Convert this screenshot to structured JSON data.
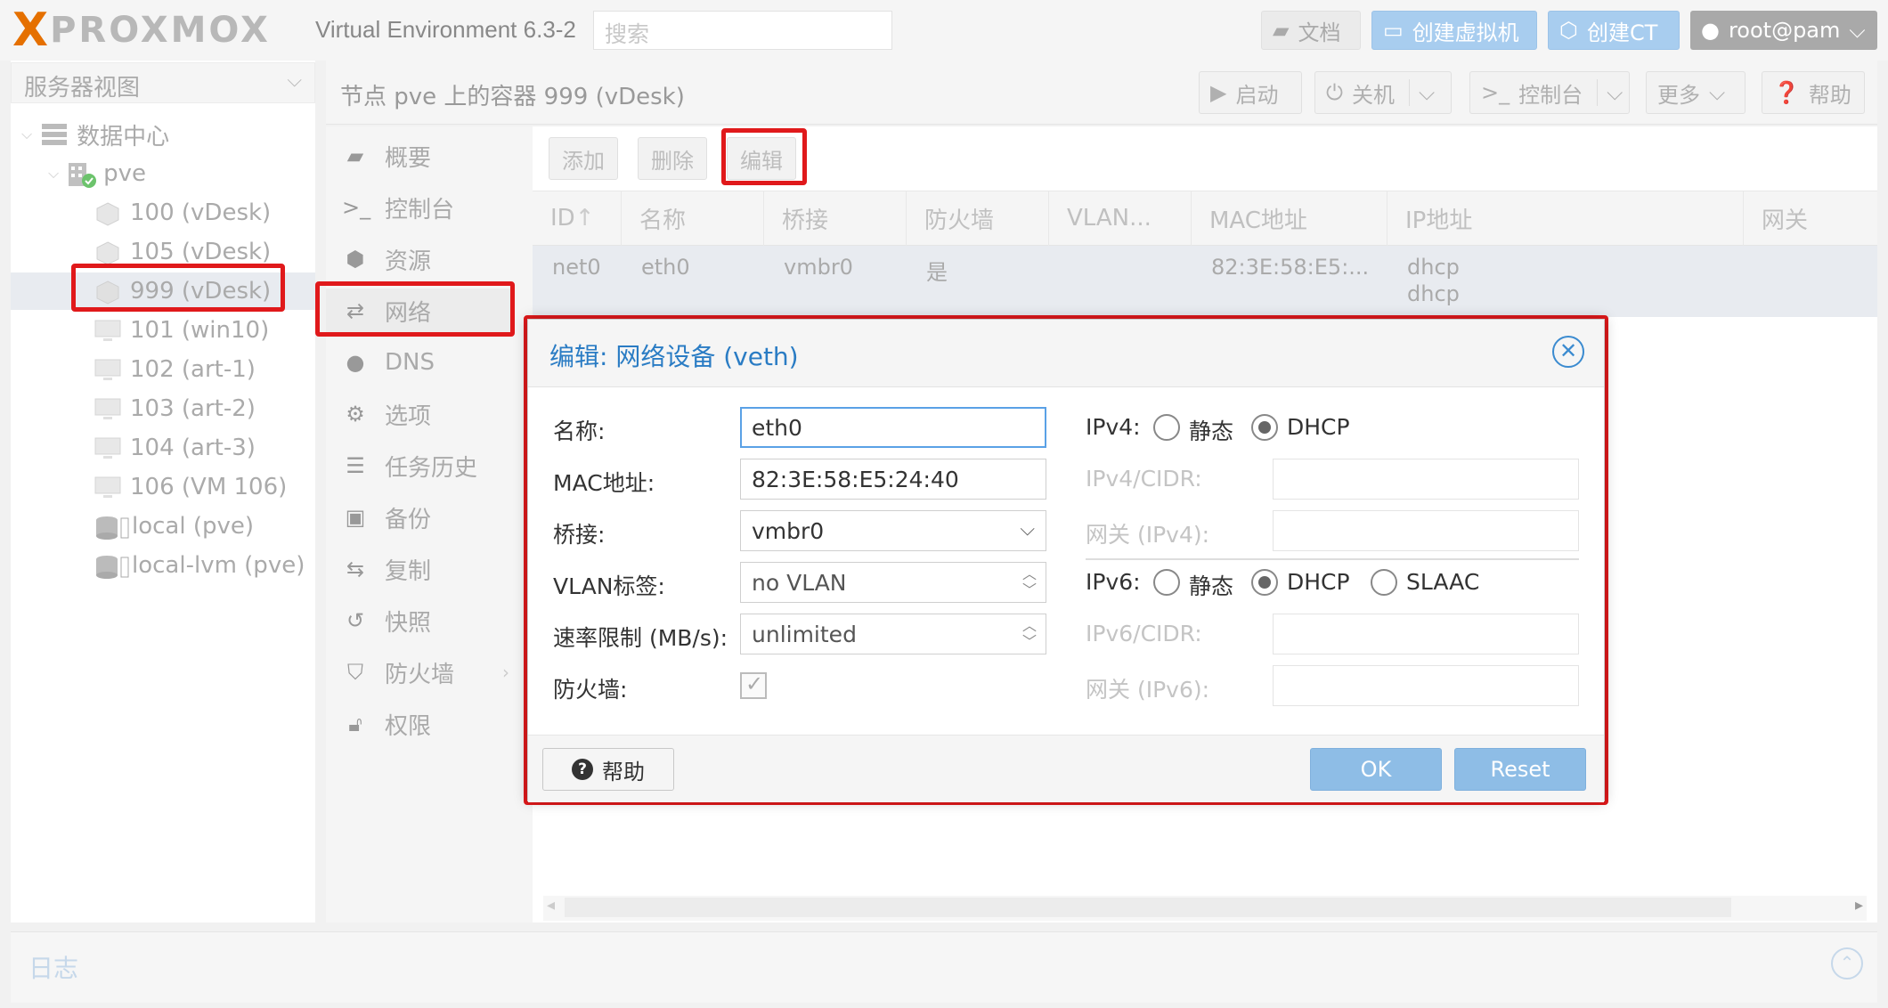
{
  "header": {
    "logo_x": "X",
    "logo_text": "PROXMOX",
    "version": "Virtual Environment 6.3-2",
    "search_placeholder": "搜索",
    "docs_label": "文档",
    "create_vm_label": "创建虚拟机",
    "create_ct_label": "创建CT",
    "user_label": "root@pam"
  },
  "tree": {
    "view_label": "服务器视图",
    "datacenter": "数据中心",
    "node": "pve",
    "items": [
      {
        "label": "100 (vDesk)"
      },
      {
        "label": "105 (vDesk)"
      },
      {
        "label": "999 (vDesk)"
      },
      {
        "label": "101 (win10)"
      },
      {
        "label": "102 (art-1)"
      },
      {
        "label": "103 (art-2)"
      },
      {
        "label": "104 (art-3)"
      },
      {
        "label": "106 (VM 106)"
      },
      {
        "label": "local (pve)"
      },
      {
        "label": "local-lvm (pve)"
      }
    ]
  },
  "main": {
    "title": "节点 pve 上的容器 999 (vDesk)",
    "toolbar": {
      "start": "启动",
      "shutdown": "关机",
      "console": "控制台",
      "more": "更多",
      "help": "帮助"
    }
  },
  "subnav": [
    {
      "label": "概要",
      "icon": "book-icon"
    },
    {
      "label": "控制台",
      "icon": "terminal-icon"
    },
    {
      "label": "资源",
      "icon": "cube-icon"
    },
    {
      "label": "网络",
      "icon": "exchange-icon"
    },
    {
      "label": "DNS",
      "icon": "globe-icon"
    },
    {
      "label": "选项",
      "icon": "gear-icon"
    },
    {
      "label": "任务历史",
      "icon": "list-icon"
    },
    {
      "label": "备份",
      "icon": "floppy-icon"
    },
    {
      "label": "复制",
      "icon": "retweet-icon"
    },
    {
      "label": "快照",
      "icon": "history-icon"
    },
    {
      "label": "防火墙",
      "icon": "shield-icon"
    },
    {
      "label": "权限",
      "icon": "unlock-icon"
    }
  ],
  "grid": {
    "add": "添加",
    "remove": "删除",
    "edit": "编辑",
    "columns": [
      "ID",
      "名称",
      "桥接",
      "防火墙",
      "VLAN...",
      "MAC地址",
      "IP地址",
      "网关"
    ],
    "row": {
      "id": "net0",
      "name": "eth0",
      "bridge": "vmbr0",
      "firewall": "是",
      "vlan": "",
      "mac": "82:3E:58:E5:...",
      "ip1": "dhcp",
      "ip2": "dhcp",
      "gateway": ""
    }
  },
  "dialog": {
    "title": "编辑: 网络设备 (veth)",
    "name_label": "名称:",
    "name_value": "eth0",
    "mac_label": "MAC地址:",
    "mac_value": "82:3E:58:E5:24:40",
    "bridge_label": "桥接:",
    "bridge_value": "vmbr0",
    "vlan_label": "VLAN标签:",
    "vlan_value": "no VLAN",
    "rate_label": "速率限制 (MB/s):",
    "rate_value": "unlimited",
    "firewall_label": "防火墙:",
    "firewall_checked": true,
    "ipv4_label": "IPv4:",
    "ipv4_static": "静态",
    "ipv4_dhcp": "DHCP",
    "ipv4_mode": "DHCP",
    "ipv4_cidr_label": "IPv4/CIDR:",
    "gw4_label": "网关 (IPv4):",
    "ipv6_label": "IPv6:",
    "ipv6_static": "静态",
    "ipv6_dhcp": "DHCP",
    "ipv6_slaac": "SLAAC",
    "ipv6_mode": "DHCP",
    "ipv6_cidr_label": "IPv6/CIDR:",
    "gw6_label": "网关 (IPv6):",
    "help": "帮助",
    "ok": "OK",
    "reset": "Reset"
  },
  "log": {
    "title": "日志"
  },
  "colors": {
    "highlight": "#e0191b",
    "accent": "#2a7cc4",
    "logo_orange": "#e57000",
    "button_blue": "#8ebde6"
  }
}
